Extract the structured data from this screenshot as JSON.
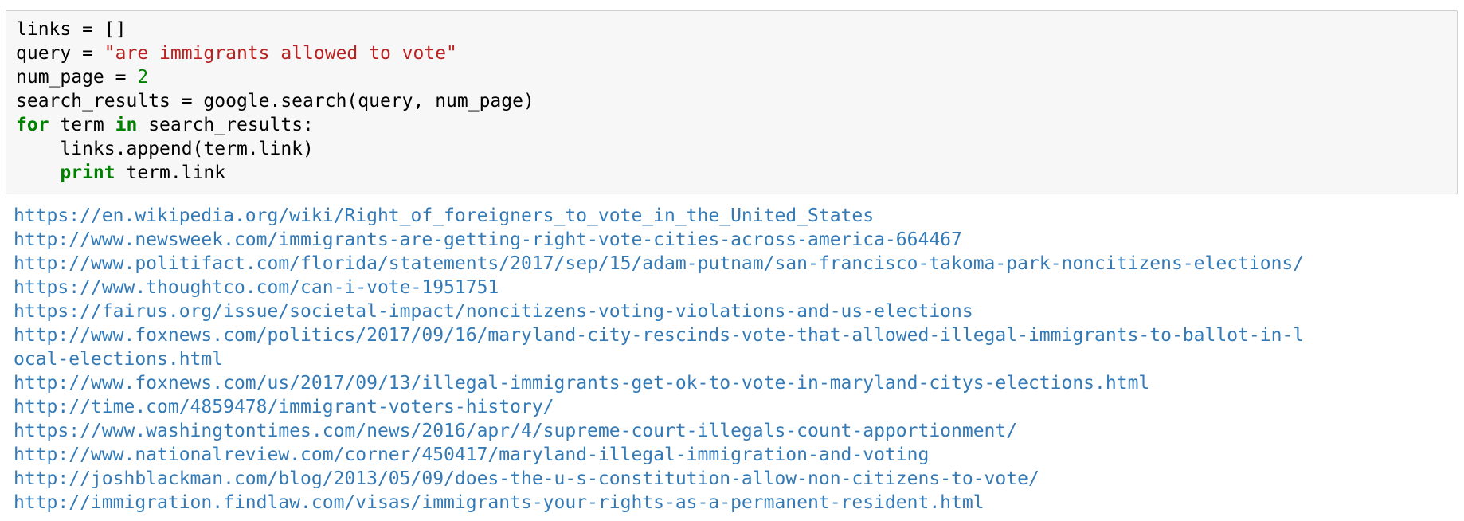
{
  "input_cell": {
    "lines": [
      "links = []",
      "query = \"are immigrants allowed to vote\"",
      "num_page = 2",
      "search_results = google.search(query, num_page)",
      "for term in search_results:",
      "    links.append(term.link)",
      "    print term.link"
    ],
    "colors": {
      "cell_background": "#f7f7f7",
      "cell_border": "#cfcfcf",
      "string": "#ba2121",
      "number_keyword": "#008000",
      "output_link": "#337ab7"
    }
  },
  "output": {
    "lines": [
      "https://en.wikipedia.org/wiki/Right_of_foreigners_to_vote_in_the_United_States",
      "http://www.newsweek.com/immigrants-are-getting-right-vote-cities-across-america-664467",
      "http://www.politifact.com/florida/statements/2017/sep/15/adam-putnam/san-francisco-takoma-park-noncitizens-elections/",
      "https://www.thoughtco.com/can-i-vote-1951751",
      "https://fairus.org/issue/societal-impact/noncitizens-voting-violations-and-us-elections",
      "http://www.foxnews.com/politics/2017/09/16/maryland-city-rescinds-vote-that-allowed-illegal-immigrants-to-ballot-in-l",
      "ocal-elections.html",
      "http://www.foxnews.com/us/2017/09/13/illegal-immigrants-get-ok-to-vote-in-maryland-citys-elections.html",
      "http://time.com/4859478/immigrant-voters-history/",
      "https://www.washingtontimes.com/news/2016/apr/4/supreme-court-illegals-count-apportionment/",
      "http://www.nationalreview.com/corner/450417/maryland-illegal-immigration-and-voting",
      "http://joshblackman.com/blog/2013/05/09/does-the-u-s-constitution-allow-non-citizens-to-vote/",
      "http://immigration.findlaw.com/visas/immigrants-your-rights-as-a-permanent-resident.html"
    ]
  }
}
